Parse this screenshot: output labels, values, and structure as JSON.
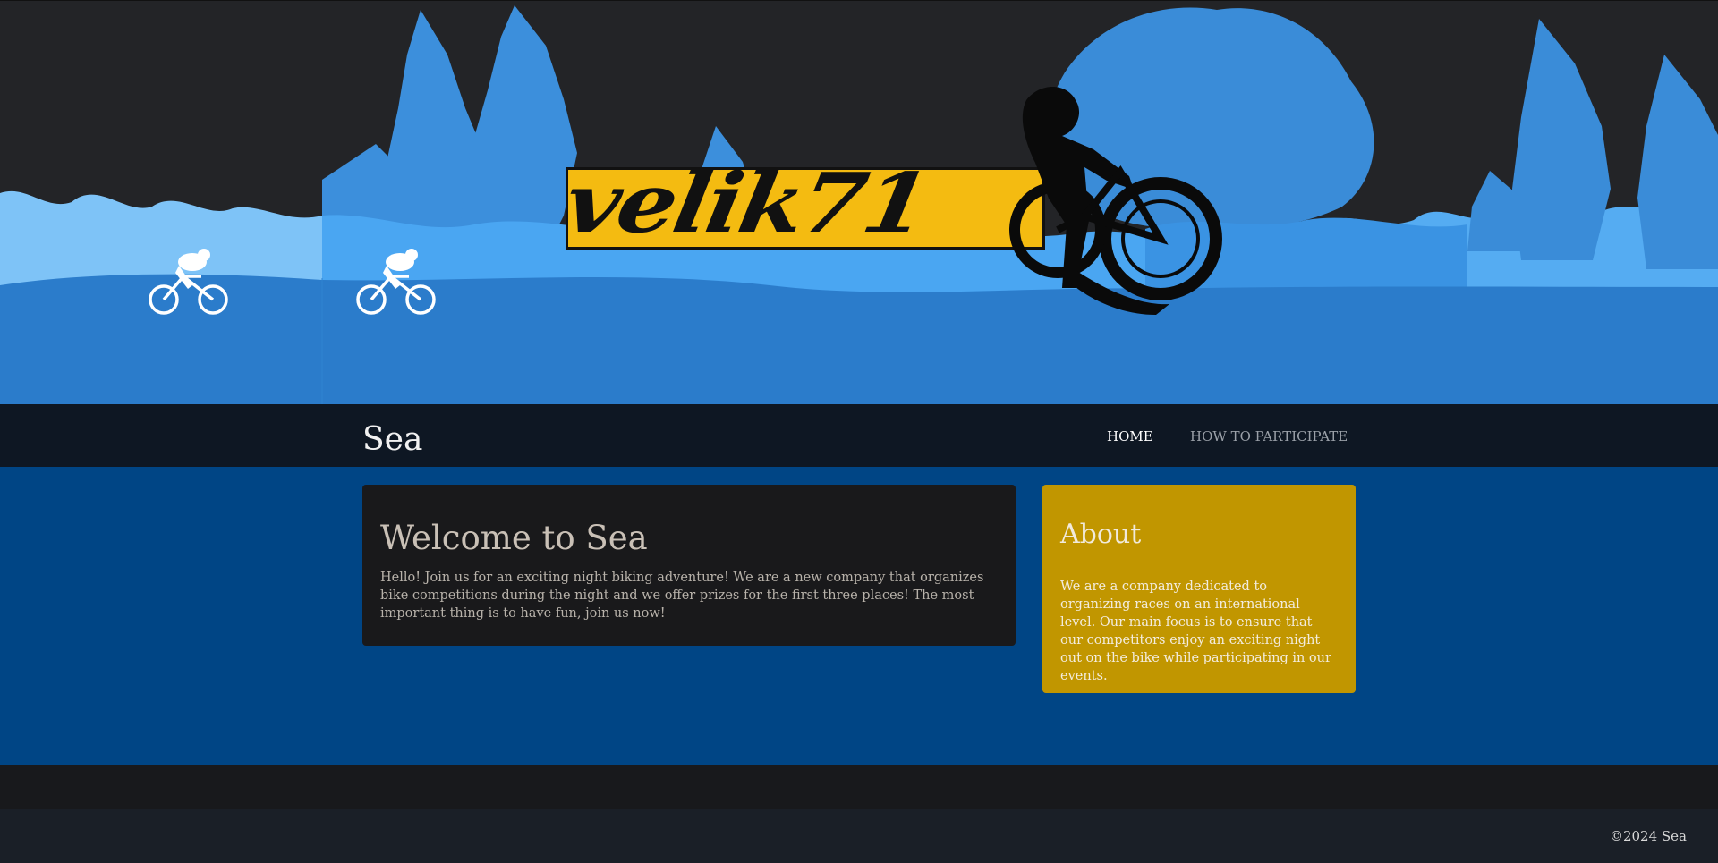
{
  "hero": {
    "logo_text": "velik71",
    "colors": {
      "sky": "#232427",
      "trees_dark": "#2f86d8",
      "trees_light": "#4aa6f2",
      "ground": "#2b7ccb",
      "logo_yellow": "#f4bb11"
    }
  },
  "navbar": {
    "brand": "Sea",
    "links": [
      {
        "label": "HOME",
        "active": true
      },
      {
        "label": "HOW TO PARTICIPATE",
        "active": false
      }
    ]
  },
  "main": {
    "welcome": {
      "title": "Welcome to Sea",
      "text": "Hello! Join us for an exciting night biking adventure! We are a new company that organizes bike competitions during the night and we offer prizes for the first three places! The most important thing is to have fun, join us now!"
    },
    "about": {
      "title": "About",
      "text": "We are a company dedicated to organizing races on an international level. Our main focus is to ensure that our competitors enjoy an exciting night out on the bike while participating in our events."
    }
  },
  "footer": {
    "copyright": "©2024 Sea"
  }
}
